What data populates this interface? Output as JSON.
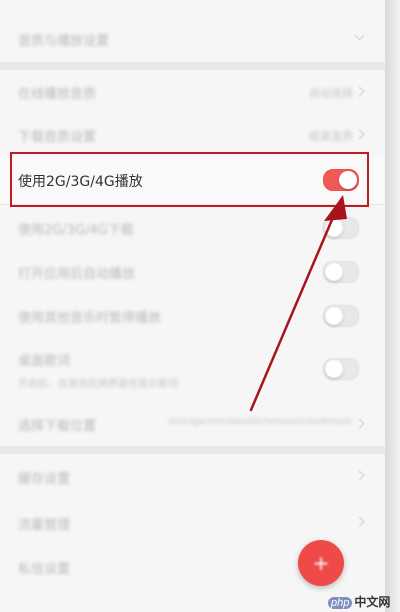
{
  "settings": {
    "rows": [
      {
        "label": "音质与播放设置",
        "value": ""
      },
      {
        "label": "在线播放音质",
        "value": "自动选择"
      },
      {
        "label": "下载音质设置",
        "value": "极高音质"
      },
      {
        "label": "使用2G/3G/4G播放",
        "value": ""
      },
      {
        "label": "使用2G/3G/4G下载",
        "value": ""
      },
      {
        "label": "打开应用后自动播放",
        "value": ""
      },
      {
        "label": "使用其他音乐时暂停播放",
        "value": ""
      },
      {
        "label": "桌面歌词",
        "sub": "开启后，在其他应用界面也显示歌词",
        "value": ""
      },
      {
        "label": "选择下载位置",
        "value": "/storage/emulated/0/netease/cloudmusic"
      },
      {
        "label": "缓存设置",
        "value": ""
      },
      {
        "label": "流量管理",
        "value": ""
      },
      {
        "label": "私信设置",
        "value": ""
      }
    ],
    "toggles": {
      "mobile_play": true,
      "mobile_download": false,
      "auto_play": false,
      "pause_on_other": false,
      "desktop_lyrics": false
    }
  },
  "fab": {
    "label": "+"
  },
  "watermark": {
    "brand": "php",
    "site": "中文网"
  },
  "colors": {
    "accent": "#f05a56",
    "highlight_box": "#c11b22",
    "arrow": "#a8141c",
    "background": "#f4f4f4"
  }
}
